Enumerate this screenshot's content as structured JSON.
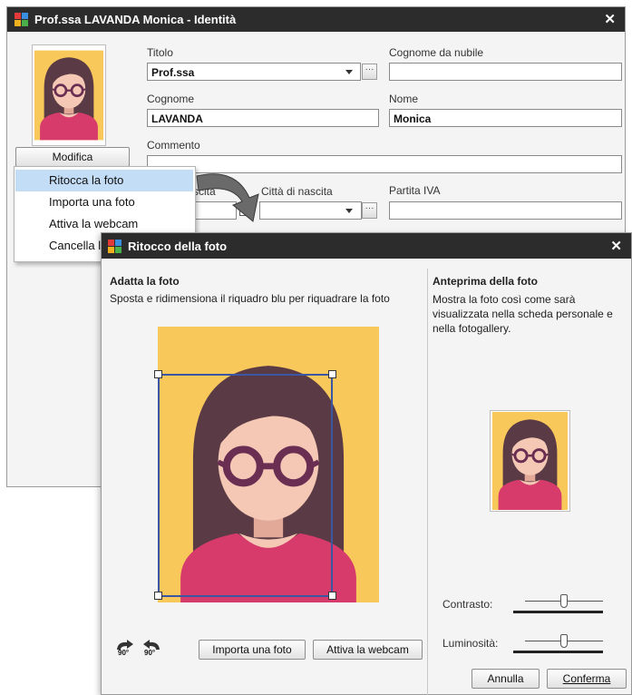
{
  "main_window": {
    "title": "Prof.ssa LAVANDA Monica - Identità",
    "close_glyph": "✕",
    "fields": {
      "titolo_label": "Titolo",
      "titolo_value": "Prof.ssa",
      "cognome_nubile_label": "Cognome da nubile",
      "cognome_nubile_value": "",
      "cognome_label": "Cognome",
      "cognome_value": "LAVANDA",
      "nome_label": "Nome",
      "nome_value": "Monica",
      "commento_label": "Commento",
      "commento_value": "",
      "data_nascita_label_partial": "scita",
      "citta_nascita_label": "Città di nascita",
      "citta_nascita_value": "",
      "partita_iva_label": "Partita IVA",
      "partita_iva_value": ""
    },
    "modifica_button": "Modifica",
    "ellipsis": "···"
  },
  "context_menu": {
    "items": [
      "Ritocca la foto",
      "Importa una foto",
      "Attiva la webcam",
      "Cancella l"
    ],
    "selected_index": 0
  },
  "dialog": {
    "title": "Ritocco della foto",
    "close_glyph": "✕",
    "left_heading": "Adatta la foto",
    "left_description": "Sposta e ridimensiona il riquadro blu per riquadrare la foto",
    "right_heading": "Anteprima della foto",
    "right_description": "Mostra la foto così come sarà visualizzata nella scheda personale e nella fotogallery.",
    "rotate_right_label": "90°",
    "rotate_left_label": "90°",
    "import_button": "Importa una foto",
    "webcam_button": "Attiva la webcam",
    "contrast_label": "Contrasto:",
    "brightness_label": "Luminosità:",
    "contrast_value": 0.5,
    "brightness_value": 0.5,
    "cancel_button": "Annulla",
    "confirm_button": "Conferma"
  },
  "colors": {
    "titlebar": "#2c2c2c",
    "photo_background": "#f8c95a",
    "hair": "#5a3a44",
    "skin": "#f4c8b4",
    "shirt": "#d63b6b",
    "glasses": "#6a2e52",
    "crop_frame": "#3b57a3",
    "menu_selected": "#c4ddf6"
  },
  "icons": {
    "app": "app-logo-icon",
    "dropdown": "chevron-down-icon",
    "calendar": "calendar-icon",
    "rotate_cw": "rotate-right-icon",
    "rotate_ccw": "rotate-left-icon",
    "arrow": "curved-arrow-icon"
  }
}
